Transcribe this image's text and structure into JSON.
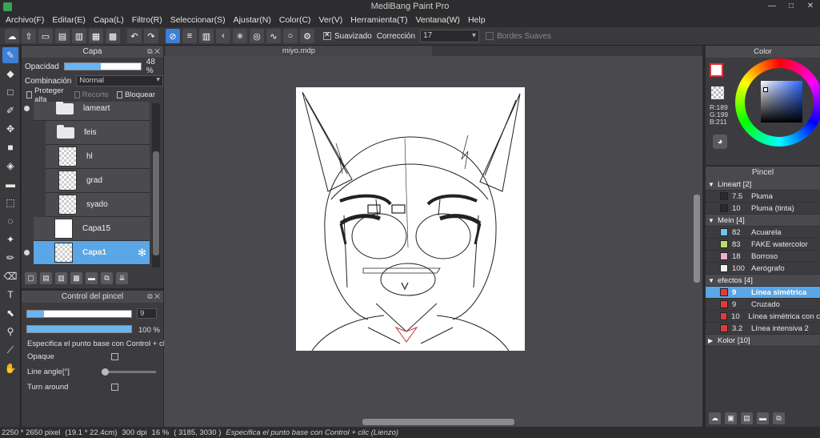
{
  "window": {
    "title": "MediBang Paint Pro",
    "controls": [
      "—",
      "□",
      "✕"
    ]
  },
  "menu": [
    "Archivo(F)",
    "Editar(E)",
    "Capa(L)",
    "Filtro(R)",
    "Seleccionar(S)",
    "Ajustar(N)",
    "Color(C)",
    "Ver(V)",
    "Herramienta(T)",
    "Ventana(W)",
    "Help"
  ],
  "toolbar": {
    "smoothing_label": "Suavizado",
    "correction_label": "Corrección",
    "correction_value": "17",
    "soft_edges_label": "Bordes Suaves"
  },
  "layer_panel": {
    "title": "Capa",
    "opacity_label": "Opacidad",
    "opacity_value": "48 %",
    "opacity_fraction": 0.48,
    "blend_label": "Combinación",
    "blend_value": "Normal",
    "protect_alpha": "Proteger alfa",
    "clipping": "Recorte",
    "lock": "Bloquear",
    "layers": [
      {
        "name": "lameart",
        "type": "folder",
        "visible": true
      },
      {
        "name": "feis",
        "type": "folder",
        "visible": false
      },
      {
        "name": "hl",
        "type": "layer",
        "visible": false
      },
      {
        "name": "grad",
        "type": "layer",
        "visible": false
      },
      {
        "name": "syado",
        "type": "layer",
        "visible": false
      },
      {
        "name": "Capa15",
        "type": "layer",
        "visible": false
      },
      {
        "name": "Capa1",
        "type": "layer",
        "visible": true,
        "selected": true
      }
    ]
  },
  "brush_control": {
    "title": "Control del pincel",
    "size_value": "9",
    "opacity_value": "100 %",
    "hint": "Especifica el punto base con Control + clic (Li",
    "opaque_label": "Opaque",
    "line_angle_label": "Line angle[°]",
    "turn_around_label": "Turn around"
  },
  "document": {
    "tab": "miyo.mdp"
  },
  "color_panel": {
    "title": "Color",
    "r": "R:189",
    "g": "G:199",
    "b": "B:211"
  },
  "brush_panel": {
    "title": "Pincel",
    "groups": [
      {
        "name": "Lineart [2]",
        "expanded": true,
        "items": [
          {
            "size": "7.5",
            "name": "Pluma",
            "color": "#2a2a2a"
          },
          {
            "size": "10",
            "name": "Pluma (tinta)",
            "color": "#2a2a2a"
          }
        ]
      },
      {
        "name": "Mein [4]",
        "expanded": true,
        "items": [
          {
            "size": "82",
            "name": "Acuarela",
            "color": "#6fc3ee"
          },
          {
            "size": "83",
            "name": "FAKE watercolor",
            "color": "#b6de6a"
          },
          {
            "size": "18",
            "name": "Borroso",
            "color": "#f4a9d3"
          },
          {
            "size": "100",
            "name": "Aerógrafo",
            "color": "#f2f2f2"
          }
        ]
      },
      {
        "name": "efectos [4]",
        "expanded": true,
        "items": [
          {
            "size": "9",
            "name": "Línea simétrica",
            "color": "#e03a3a",
            "selected": true
          },
          {
            "size": "9",
            "name": "Cruzado",
            "color": "#e03a3a"
          },
          {
            "size": "10",
            "name": "Línea simétrica con c",
            "color": "#e03a3a"
          },
          {
            "size": "3.2",
            "name": "Línea intensiva 2",
            "color": "#e03a3a"
          }
        ]
      },
      {
        "name": "Kolor [10]",
        "expanded": false,
        "items": []
      }
    ]
  },
  "status": {
    "size": "2250 * 2650 pixel",
    "cm": "(19.1 * 22.4cm)",
    "dpi": "300 dpi",
    "zoom": "16 %",
    "coords": "( 3185, 3030 )",
    "hint": "Especifica el punto base con Control + clic (Lienzo)"
  }
}
